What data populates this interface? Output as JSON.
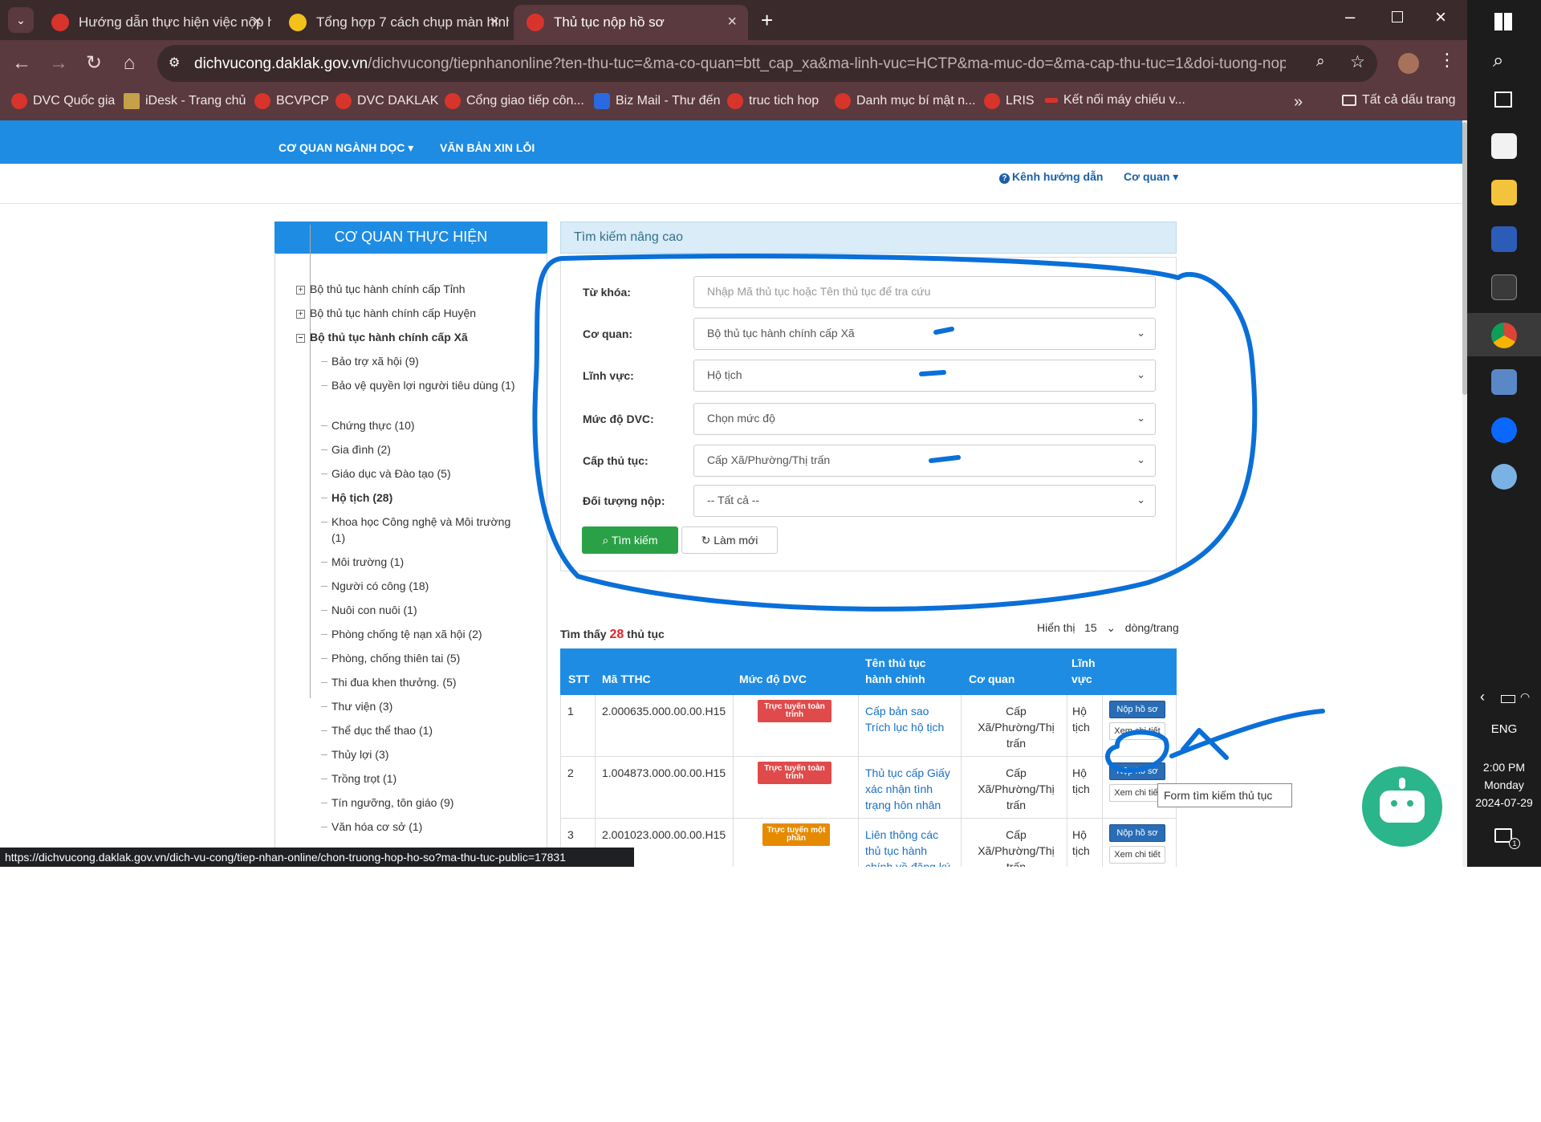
{
  "browser": {
    "tabs": [
      {
        "title": "Hướng dẫn thực hiện việc nộp h",
        "active": false
      },
      {
        "title": "Tổng hợp 7 cách chụp màn hình",
        "active": false
      },
      {
        "title": "Thủ tục nộp hồ sơ",
        "active": true
      }
    ],
    "url_domain": "dichvucong.daklak.gov.vn",
    "url_path": "/dichvucong/tiepnhanonline?ten-thu-tuc=&ma-co-quan=btt_cap_xa&ma-linh-vuc=HCTP&ma-muc-do=&ma-cap-thu-tuc=1&doi-tuong-nop=&tokenC...",
    "bookmarks": [
      "DVC Quốc gia",
      "iDesk - Trang chủ",
      "BCVPCP",
      "DVC DAKLAK",
      "Cổng giao tiếp côn...",
      "Biz Mail - Thư đến",
      "truc tich hop",
      "Danh mục bí mật n...",
      "LRIS",
      "Kết nối máy chiếu v..."
    ],
    "all_bookmarks": "Tất cả dấu trang",
    "status_url": "https://dichvucong.daklak.gov.vn/dich-vu-cong/tiep-nhan-online/chon-truong-hop-ho-so?ma-thu-tuc-public=17831"
  },
  "taskbar": {
    "lang": "ENG",
    "time": "2:00 PM",
    "day": "Monday",
    "date": "2024-07-29",
    "notif_count": "1"
  },
  "nav": {
    "items": [
      "CƠ QUAN NGÀNH DỌC ▾",
      "VĂN BẢN XIN LỖI"
    ],
    "guide_link": "Kênh hướng dẫn",
    "agency_link": "Cơ quan ▾"
  },
  "left": {
    "title": "CƠ QUAN THỰC HIỆN",
    "roots": [
      "Bộ thủ tục hành chính cấp Tỉnh",
      "Bộ thủ tục hành chính cấp Huyện",
      "Bộ thủ tục hành chính cấp Xã"
    ],
    "children": [
      "Bảo trợ xã hội (9)",
      "Bảo vệ quyền lợi người tiêu dùng (1)",
      "Chứng thực (10)",
      "Gia đình (2)",
      "Giáo dục và Đào tạo (5)",
      "Hộ tịch (28)",
      "Khoa học Công nghệ và Môi trường (1)",
      "Môi trường (1)",
      "Người có công (18)",
      "Nuôi con nuôi (1)",
      "Phòng chống tệ nạn xã hội (2)",
      "Phòng, chống thiên tai (5)",
      "Thi đua khen thưởng. (5)",
      "Thư viện (3)",
      "Thể dục thể thao (1)",
      "Thủy lợi (3)",
      "Trồng trọt (1)",
      "Tín ngưỡng, tôn giáo (9)",
      "Văn hóa cơ sở (1)"
    ]
  },
  "search": {
    "title": "Tìm kiếm nâng cao",
    "keyword_label": "Từ khóa:",
    "keyword_placeholder": "Nhập Mã thủ tục hoặc Tên thủ tục để tra cứu",
    "agency_label": "Cơ quan:",
    "agency_value": "Bộ thủ tục hành chính cấp Xã",
    "field_label": "Lĩnh vực:",
    "field_value": "Hộ tịch",
    "level_label": "Mức độ DVC:",
    "level_value": "Chọn mức độ",
    "tier_label": "Cấp thủ tục:",
    "tier_value": "Cấp Xã/Phường/Thị trấn",
    "target_label": "Đối tượng nộp:",
    "target_value": "-- Tất cả --",
    "search_btn": "Tìm kiếm",
    "reset_btn": "Làm mới"
  },
  "results": {
    "found_prefix": "Tìm thấy",
    "found_count": "28",
    "found_suffix": "thủ tục",
    "per_page_label": "Hiển thị",
    "per_page_value": "15",
    "per_page_suffix": "dòng/trang",
    "headers": [
      "STT",
      "Mã TTHC",
      "Mức độ DVC",
      "Tên thủ tục hành chính",
      "Cơ quan",
      "Lĩnh vực"
    ],
    "rows": [
      {
        "stt": "1",
        "code": "2.000635.000.00.00.H15",
        "level": "Trực tuyến toàn trình",
        "name": "Cấp bản sao Trích lục hộ tịch",
        "agency": "Cấp Xã/Phường/Thị trấn",
        "field": "Hộ tịch"
      },
      {
        "stt": "2",
        "code": "1.004873.000.00.00.H15",
        "level": "Trực tuyến toàn trình",
        "name": "Thủ tục cấp Giấy xác nhận tình trạng hôn nhân",
        "agency": "Cấp Xã/Phường/Thị trấn",
        "field": "Hộ tịch"
      },
      {
        "stt": "3",
        "code": "2.001023.000.00.00.H15",
        "level": "Trực tuyến một phần",
        "name": "Liên thông các thủ tục hành chính về đăng ký",
        "agency": "Cấp Xã/Phường/Thị trấn",
        "field": "Hộ tịch"
      }
    ],
    "submit_btn": "Nộp hồ sơ",
    "detail_btn": "Xem chi tiết",
    "tooltip": "Form tìm kiếm thủ tục"
  },
  "colors": {
    "primary_blue": "#1e8ce3",
    "annotation_blue": "#0a6fd8",
    "success_green": "#2aa147",
    "badge_red": "#e04a4a",
    "badge_orange": "#e68a00"
  }
}
